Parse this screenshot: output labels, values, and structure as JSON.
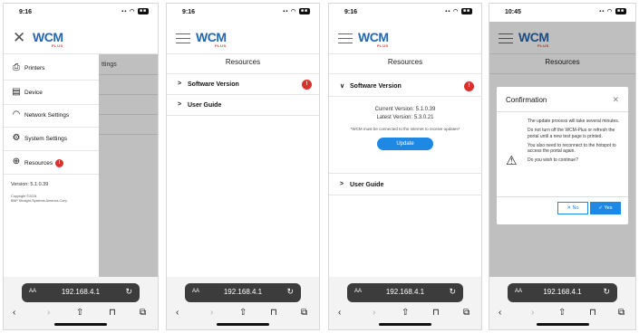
{
  "common": {
    "logo_wc": "WC",
    "logo_m": "M",
    "logo_plus": "PLUS",
    "url": "192.168.4.1",
    "aa": "AA"
  },
  "phone1": {
    "time": "9:16",
    "ghost_text": "ttings",
    "drawer_items": [
      {
        "icon": "printer-icon",
        "label": "Printers"
      },
      {
        "icon": "device-icon",
        "label": "Device"
      },
      {
        "icon": "wifi-icon",
        "label": "Network Settings"
      },
      {
        "icon": "gear-icon",
        "label": "System Settings"
      },
      {
        "icon": "globe-icon",
        "label": "Resources",
        "badge": "!"
      }
    ],
    "version": "Version: 5.1.0.39",
    "copyright_1": "Copyright ©2024",
    "copyright_2": "BNP Straight-Systems America Corp."
  },
  "phone2": {
    "time": "9:16",
    "title": "Resources",
    "rows": [
      {
        "label": "Software Version",
        "badge": "!"
      },
      {
        "label": "User Guide"
      }
    ]
  },
  "phone3": {
    "time": "9:16",
    "title": "Resources",
    "software_label": "Software Version",
    "badge": "!",
    "current_version": "Current Version: 5.1.0.39",
    "latest_version": "Latest Version: 5.3.0.21",
    "note": "*WCM must be connected to the internet to receive updates*",
    "update_label": "Update",
    "user_guide_label": "User Guide"
  },
  "phone4": {
    "time": "10:45",
    "title": "Resources",
    "dialog_title": "Confirmation",
    "para1": "The update process will take several minutes.",
    "para2": "Do not turn off the WCM-Plus or refresh the portal until a new test page is printed.",
    "para3": "You also need to reconnect to the hotspot to access the portal again.",
    "para4": "Do you wish to continue?",
    "no_label": "✕ No",
    "yes_label": "✓ Yes"
  }
}
